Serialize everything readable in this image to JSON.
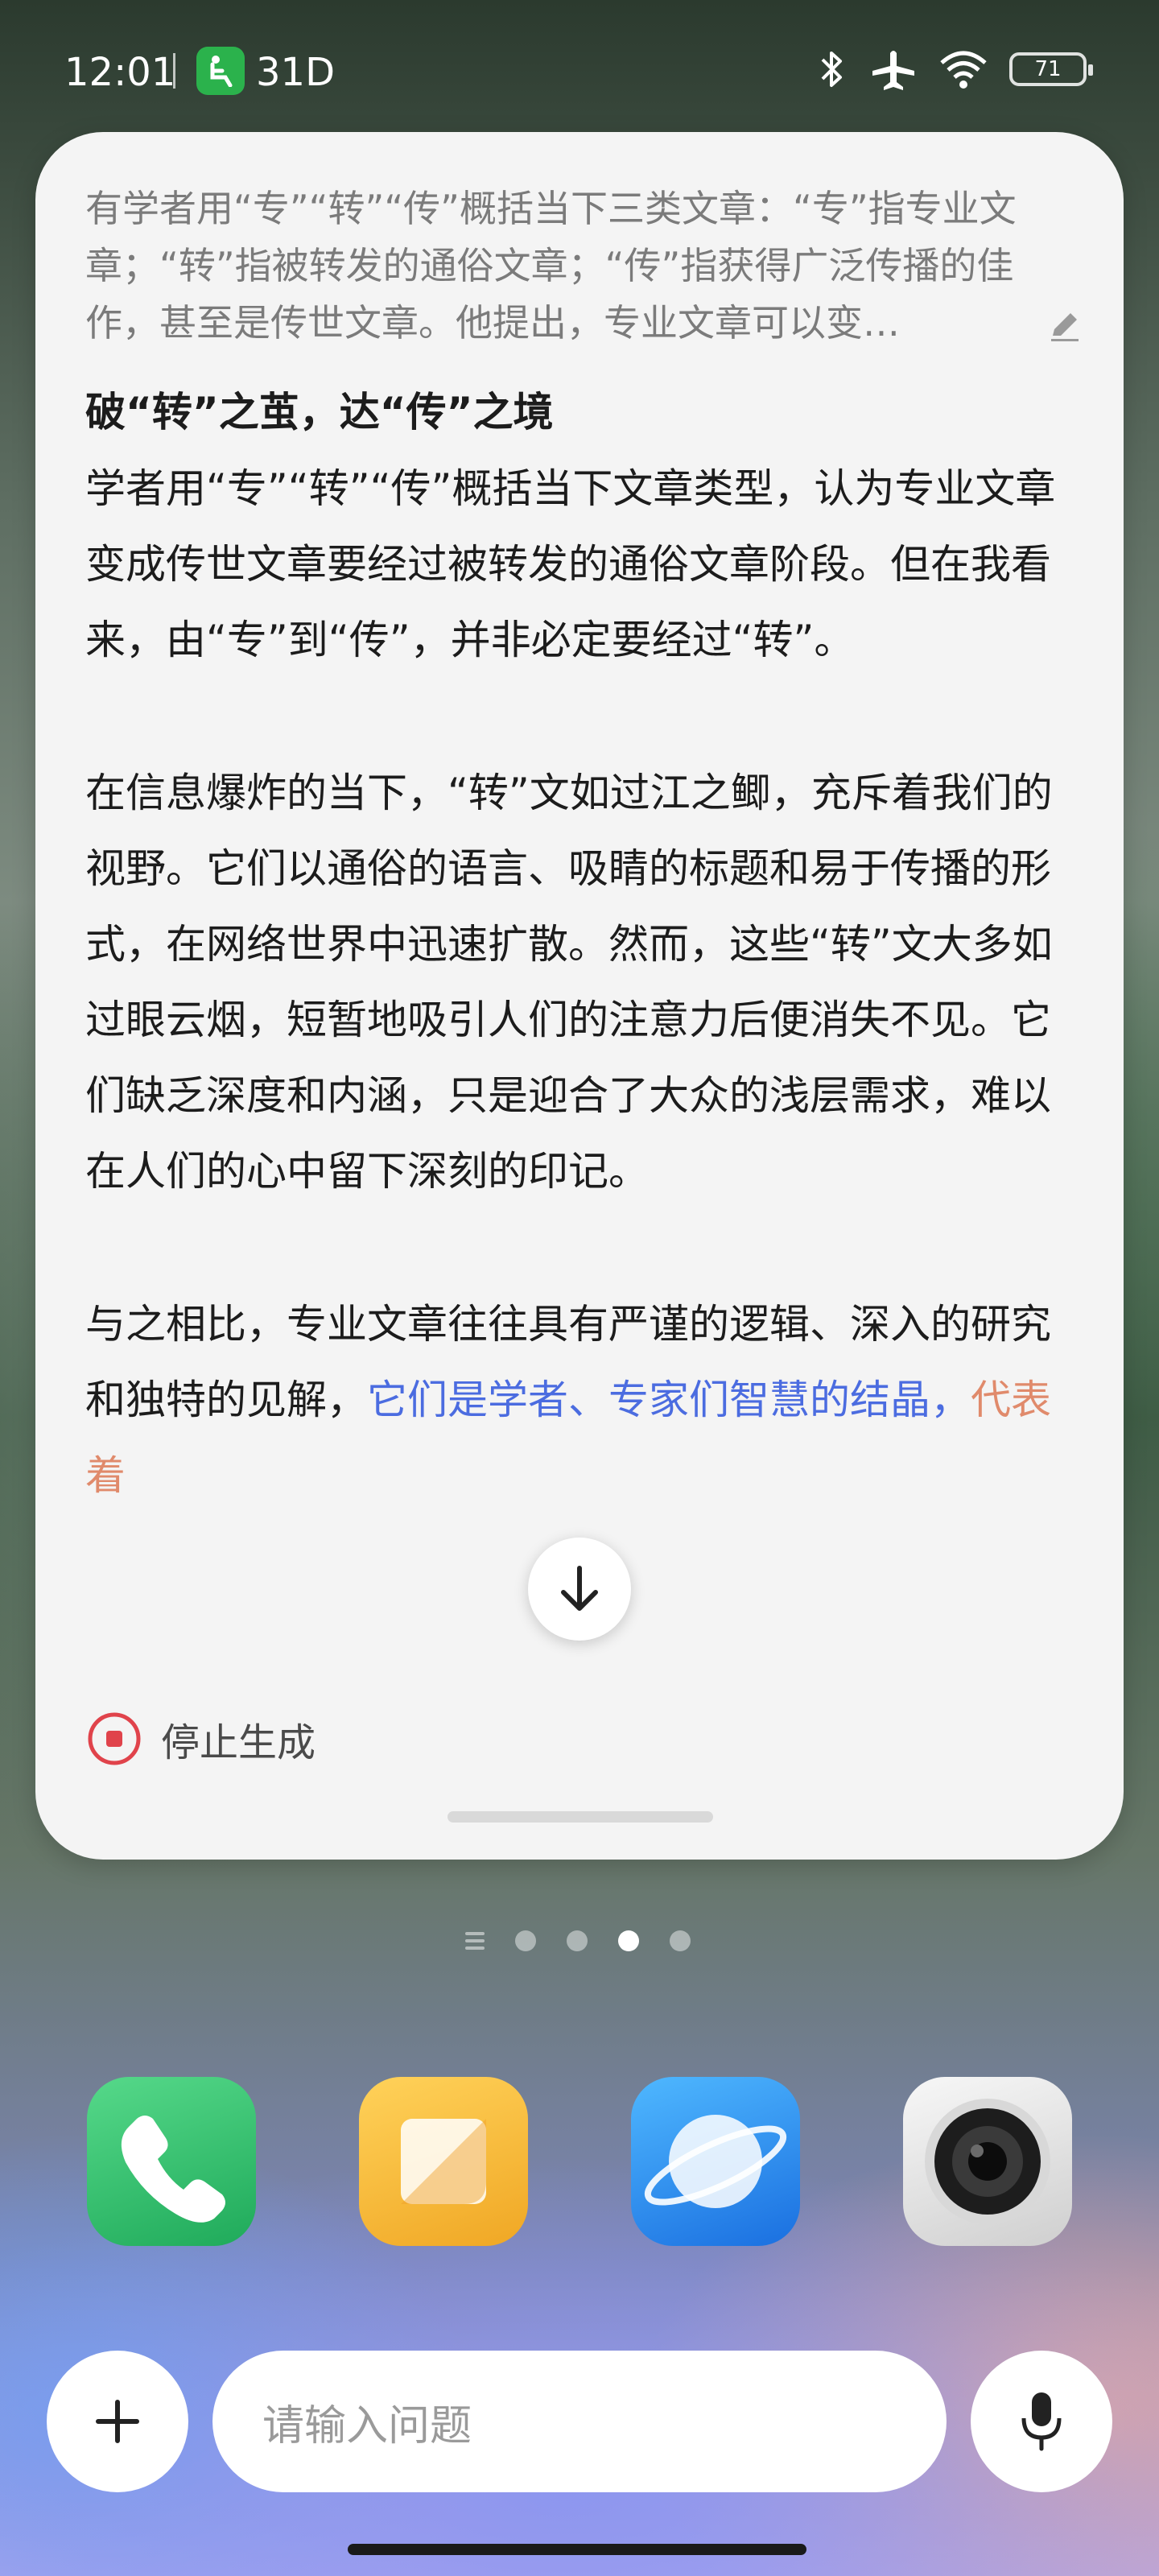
{
  "status_bar": {
    "time": "12:01",
    "badge_text": "31D",
    "battery": "71",
    "icons": [
      "bluetooth-icon",
      "airplane-icon",
      "wifi-icon",
      "battery-icon"
    ]
  },
  "card": {
    "prompt": "有学者用“专”“转”“传”概括当下三类文章：“专”指专业文章；“转”指被转发的通俗文章；“传”指获得广泛传播的佳作，甚至是传世文章。他提出，专业文章可以变…",
    "title": "破“转”之茧，达“传”之境",
    "paragraphs": [
      "学者用“专”“转”“传”概括当下文章类型，认为专业文章变成传世文章要经过被转发的通俗文章阶段。但在我看来，由“专”到“传”，并非必定要经过“转”。",
      "在信息爆炸的当下，“转”文如过江之鲫，充斥着我们的视野。它们以通俗的语言、吸睛的标题和易于传播的形式，在网络世界中迅速扩散。然而，这些“转”文大多如过眼云烟，短暂地吸引人们的注意力后便消失不见。它们缺乏深度和内涵，只是迎合了大众的浅层需求，难以在人们的心中留下深刻的印记。"
    ],
    "p3_start": "与之相比，专业文章往往具有严谨的逻辑、深入的研究和独特的见解，",
    "p3_highlight": "它们是学者、专家们智慧的结晶，",
    "p3_faded": "代表着",
    "stop_label": "停止生成"
  },
  "page_indicator": {
    "count": 4,
    "active": 3
  },
  "dock": [
    "phone-app",
    "notes-app",
    "browser-app",
    "camera-app"
  ],
  "input": {
    "placeholder": "请输入问题"
  },
  "colors": {
    "accent": "#4b6ce0",
    "stop_red": "#e0434b"
  }
}
